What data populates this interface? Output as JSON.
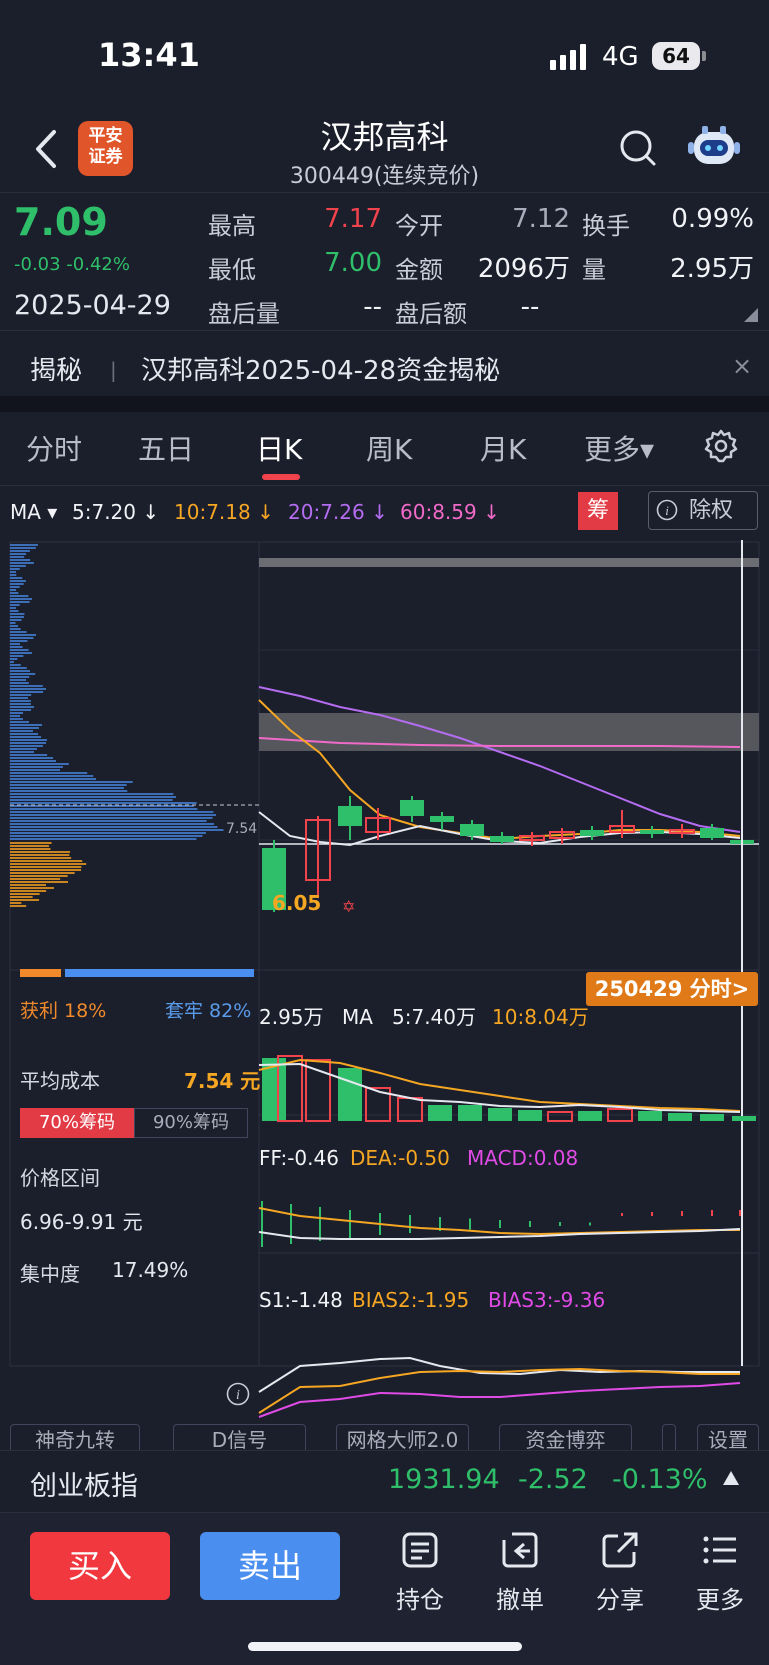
{
  "status": {
    "time": "13:41",
    "network": "4G",
    "battery": "64"
  },
  "header": {
    "broker_logo": "平安\n证券",
    "name": "汉邦高科",
    "code": "300449(连续竞价)"
  },
  "quote": {
    "price": "7.09",
    "change": "-0.03 -0.42%",
    "date": "2025-04-29",
    "high_label": "最高",
    "high": "7.17",
    "open_label": "今开",
    "open": "7.12",
    "turnover_label": "换手",
    "turnover": "0.99%",
    "low_label": "最低",
    "low": "7.00",
    "amount_label": "金额",
    "amount": "2096万",
    "volume_label": "量",
    "volume": "2.95万",
    "after_vol_label": "盘后量",
    "after_vol": "--",
    "after_amt_label": "盘后额",
    "after_amt": "--"
  },
  "news": {
    "tag": "揭秘",
    "separator": "|",
    "text": "汉邦高科2025-04-28资金揭秘",
    "close": "×"
  },
  "tabs": [
    "分时",
    "五日",
    "日K",
    "周K",
    "月K",
    "更多▾"
  ],
  "active_tab": "日K",
  "ma": {
    "label": "MA ▾",
    "ma5": "5:7.20 ↓",
    "ma10": "10:7.18 ↓",
    "ma20": "20:7.26 ↓",
    "ma60": "60:8.59 ↓",
    "chip_badge": "筹",
    "exright": "除权"
  },
  "chart": {
    "price_marker": "7.54",
    "low_marker": "6.05",
    "intraday_button": "250429 分时>"
  },
  "chips": {
    "profit": "获利 18%",
    "trapped": "套牢 82%",
    "avg_cost_label": "平均成本",
    "avg_cost": "7.54 元",
    "chip70": "70%筹码",
    "chip90": "90%筹码",
    "range_label": "价格区间",
    "range": "6.96-9.91 元",
    "concentration_label": "集中度",
    "concentration": "17.49%"
  },
  "volume_panel": {
    "vol": "2.95万",
    "ma": "MA",
    "ma5": "5:7.40万",
    "ma10": "10:8.04万"
  },
  "macd_panel": {
    "dif": "FF:-0.46",
    "dea": "DEA:-0.50",
    "macd": "MACD:0.08"
  },
  "bias_panel": {
    "bias1": "S1:-1.48",
    "bias2": "BIAS2:-1.95",
    "bias3": "BIAS3:-9.36"
  },
  "tools": [
    "神奇九转",
    "D信号",
    "网格大师2.0",
    "资金博弈",
    "",
    "设置"
  ],
  "index": {
    "name": "创业板指",
    "value": "1931.94",
    "change": "-2.52",
    "pct": "-0.13%"
  },
  "actions": {
    "buy": "买入",
    "sell": "卖出",
    "position": "持仓",
    "cancel": "撤单",
    "share": "分享",
    "more": "更多"
  },
  "colors": {
    "up": "#f0434b",
    "down": "#2fbf6a",
    "accent": "#f5a623",
    "bg": "#1b1e2b"
  }
}
